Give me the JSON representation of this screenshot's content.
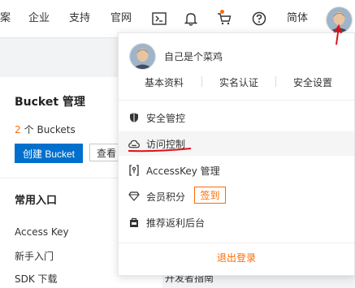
{
  "topbar": {
    "nav": [
      "案",
      "企业",
      "支持",
      "官网"
    ],
    "lang": "简体",
    "icons": [
      "terminal-icon",
      "bell-icon",
      "cart-icon",
      "help-icon"
    ]
  },
  "main": {
    "bucket_title": "Bucket 管理",
    "bucket_count_num": "2",
    "bucket_count_label": "个 Buckets",
    "create_button": "创建 Bucket",
    "view_button": "查看",
    "common_title": "常用入口",
    "links": [
      "Access Key",
      "新手入门",
      "SDK 下载"
    ],
    "dev_guide": "开发者指南"
  },
  "dropdown": {
    "username": "自己是个菜鸡",
    "quick_links": [
      "基本资料",
      "实名认证",
      "安全设置"
    ],
    "menu": [
      {
        "label": "安全管控",
        "icon": "shield-icon"
      },
      {
        "label": "访问控制",
        "icon": "cloud-icon"
      },
      {
        "label": "AccessKey 管理",
        "icon": "key-icon"
      },
      {
        "label": "会员积分",
        "icon": "diamond-icon"
      },
      {
        "label": "推荐返利后台",
        "icon": "bag-icon"
      }
    ],
    "sign_in_button": "签到",
    "logout": "退出登录"
  },
  "colors": {
    "accent_orange": "#ff6a00",
    "primary_blue": "#0070cc",
    "annotation_red": "#e0101a"
  }
}
